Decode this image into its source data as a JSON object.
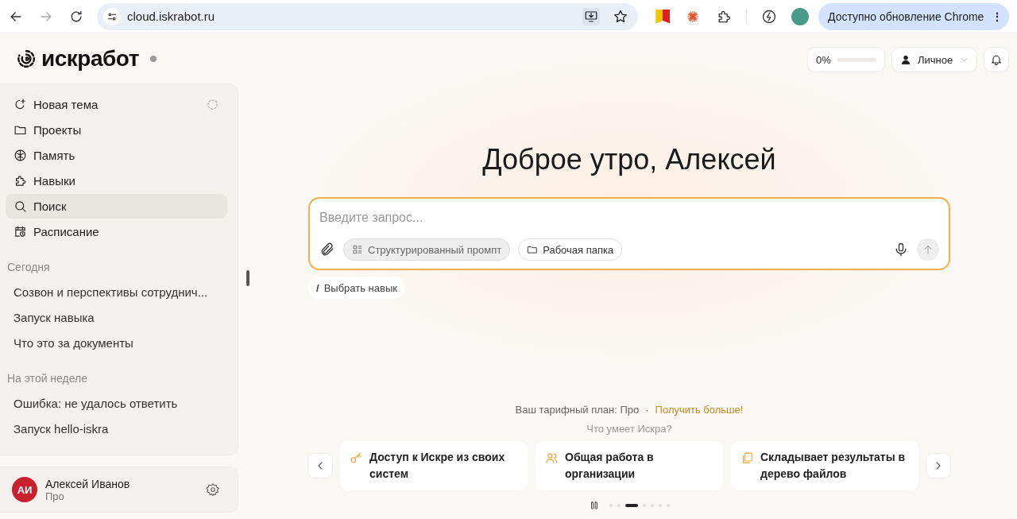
{
  "browser": {
    "url": "cloud.iskrabot.ru",
    "update_button": "Доступно обновление Chrome",
    "menu_glyph": "⋮"
  },
  "logo": {
    "text": "искработ"
  },
  "sidebar": {
    "items": [
      {
        "label": "Новая тема",
        "selected": false
      },
      {
        "label": "Проекты",
        "selected": false
      },
      {
        "label": "Память",
        "selected": false
      },
      {
        "label": "Навыки",
        "selected": false
      },
      {
        "label": "Поиск",
        "selected": true
      },
      {
        "label": "Расписание",
        "selected": false
      }
    ],
    "history": [
      {
        "heading": "Сегодня",
        "items": [
          "Созвон и перспективы сотруднич...",
          "Запуск навыка",
          "Что это за документы"
        ]
      },
      {
        "heading": "На этой неделе",
        "items": [
          "Ошибка: не удалось ответить",
          "Запуск hello-iskra"
        ]
      }
    ]
  },
  "user": {
    "initials": "АИ",
    "name": "Алексей Иванов",
    "plan": "Про"
  },
  "topbar": {
    "usage": {
      "reading": "0%",
      "level": 0
    },
    "workspace": "Личное"
  },
  "greeting": "Доброе утро, Алексей",
  "composer": {
    "placeholder": "Введите запрос...",
    "chips": [
      {
        "label": "Структурированный промпт",
        "selected": true
      },
      {
        "label": "Рабочая папка",
        "selected": false
      }
    ],
    "skill_button": {
      "glyph": "/",
      "label": "Выбрать навык"
    }
  },
  "plan": {
    "text": "Ваш тарифный план: Про",
    "separator": "·",
    "link": "Получить больше!"
  },
  "features": {
    "heading": "Что умеет Искра?",
    "cards": [
      {
        "text": "Доступ к Искре из своих систем"
      },
      {
        "text": "Общая работа в организации"
      },
      {
        "text": "Складывает результаты в дерево файлов"
      }
    ],
    "dots": [
      {
        "selected": false
      },
      {
        "selected": false
      },
      {
        "selected": true
      },
      {
        "selected": false
      },
      {
        "selected": false
      },
      {
        "selected": false
      },
      {
        "selected": false
      }
    ]
  }
}
